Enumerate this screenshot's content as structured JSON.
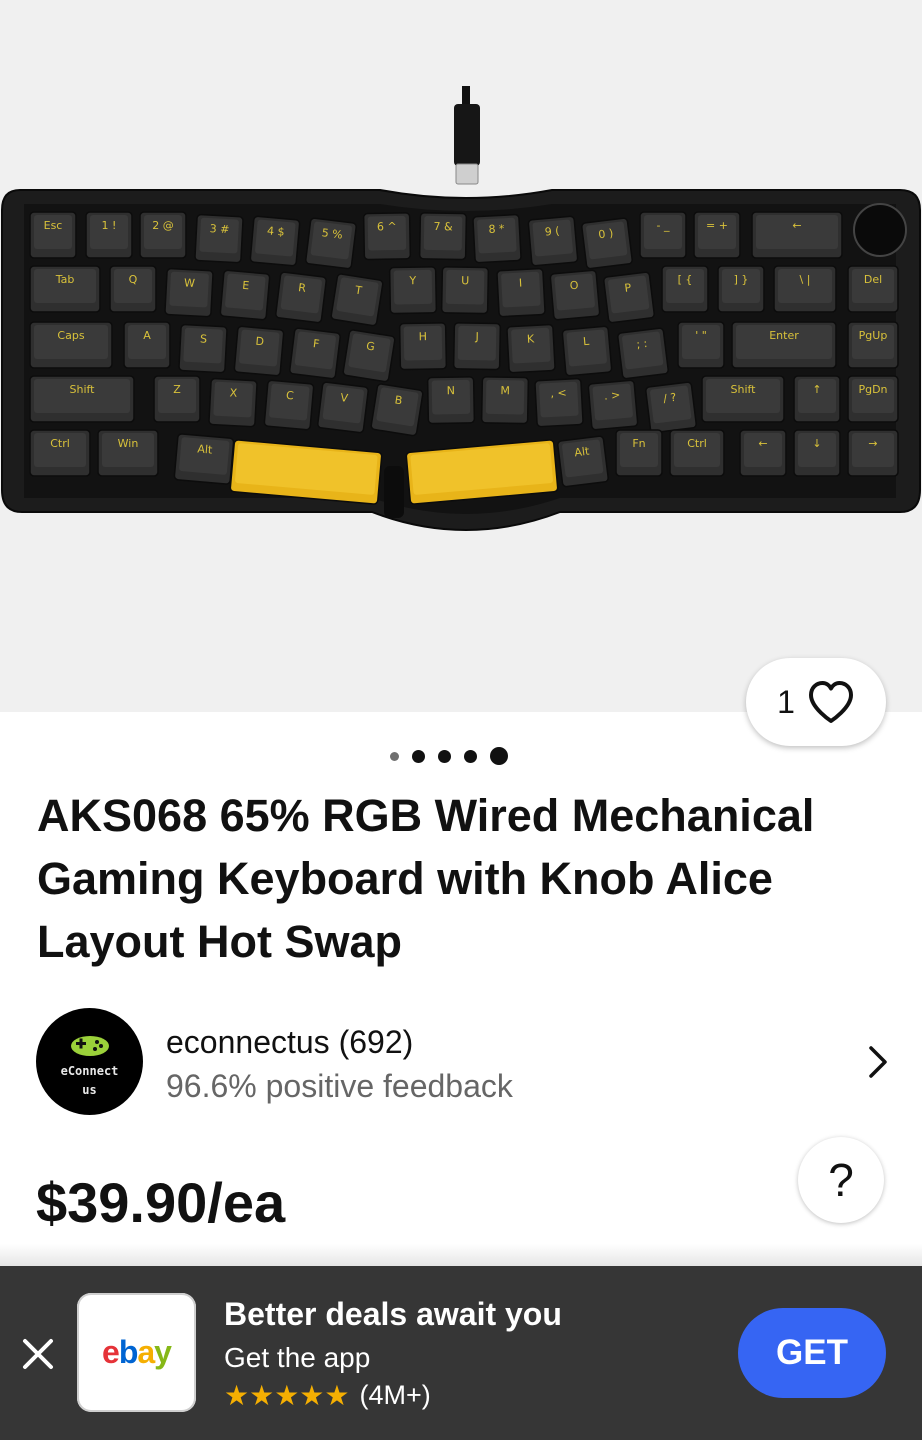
{
  "gallery": {
    "like_count": "1",
    "dots": 5,
    "active_dot": 5,
    "keyboard_keys": {
      "row1": [
        "Esc",
        "1 !",
        "2 @",
        "3 #",
        "4 $",
        "5 %",
        "6 ^",
        "7 &",
        "8 *",
        "9 (",
        "0 )",
        "- _",
        "= +",
        "←"
      ],
      "row2": [
        "Tab",
        "Q",
        "W",
        "E",
        "R",
        "T",
        "Y",
        "U",
        "I",
        "O",
        "P",
        "[ {",
        "] }",
        "\\ |",
        "Del"
      ],
      "row3": [
        "Caps",
        "A",
        "S",
        "D",
        "F",
        "G",
        "H",
        "J",
        "K",
        "L",
        "; :",
        "' \"",
        "Enter",
        "PgUp"
      ],
      "row4": [
        "Shift",
        "Z",
        "X",
        "C",
        "V",
        "B",
        "N",
        "M",
        ", <",
        ". >",
        "/ ?",
        "Shift",
        "↑",
        "PgDn"
      ],
      "row5": [
        "Ctrl",
        "Win",
        "Alt",
        "Alt",
        "Fn",
        "Ctrl",
        "←",
        "↓",
        "→"
      ]
    }
  },
  "product": {
    "title": "AKS068 65% RGB Wired Mechanical Gaming Keyboard with Knob Alice Layout Hot Swap",
    "price": "$39.90/ea"
  },
  "seller": {
    "avatar_line1": "eConnect",
    "avatar_line2": "us",
    "name": "econnectus (692)",
    "feedback": "96.6% positive feedback"
  },
  "help_label": "?",
  "banner": {
    "title": "Better deals await you",
    "subtitle": "Get the app",
    "stars": "★★★★★",
    "review_count": "(4M+)",
    "get_label": "GET",
    "app_icon_text": [
      "e",
      "b",
      "a",
      "y"
    ]
  },
  "colors": {
    "accent": "#3665f3",
    "banner_bg": "#363636",
    "star": "#f5af02",
    "keycap_yellow": "#e8b419"
  }
}
